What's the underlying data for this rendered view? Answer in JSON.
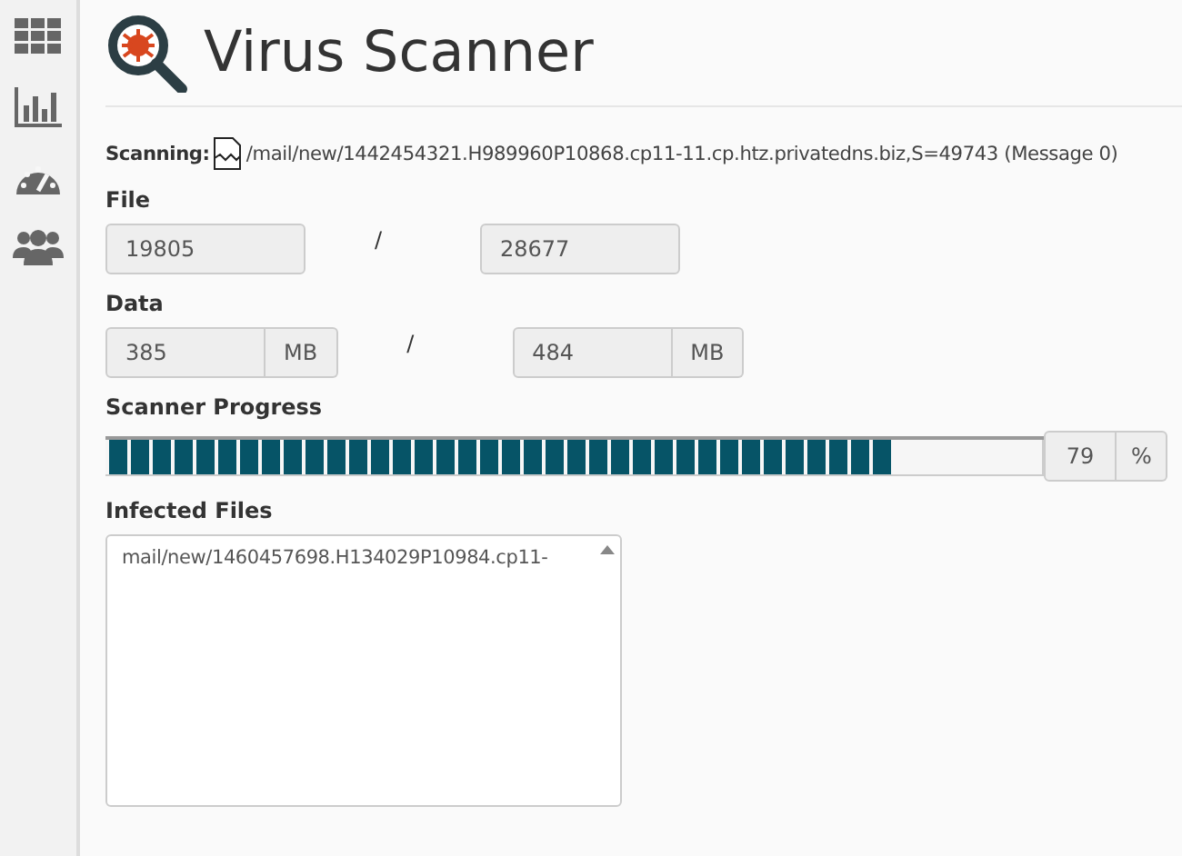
{
  "page_title": "Virus Scanner",
  "scanning": {
    "label": "Scanning:",
    "path": "/mail/new/1442454321.H989960P10868.cp11-11.cp.htz.privatedns.biz,S=49743 (Message 0)"
  },
  "file": {
    "label": "File",
    "current": "19805",
    "separator": "/",
    "total": "28677"
  },
  "data": {
    "label": "Data",
    "current": "385",
    "current_unit": "MB",
    "separator": "/",
    "total": "484",
    "total_unit": "MB"
  },
  "progress": {
    "label": "Scanner Progress",
    "level": 0.84,
    "reading": "79",
    "unit": "%"
  },
  "infected": {
    "label": "Infected Files",
    "files": [
      "mail/new/1460457698.H134029P10984.cp11-"
    ]
  }
}
